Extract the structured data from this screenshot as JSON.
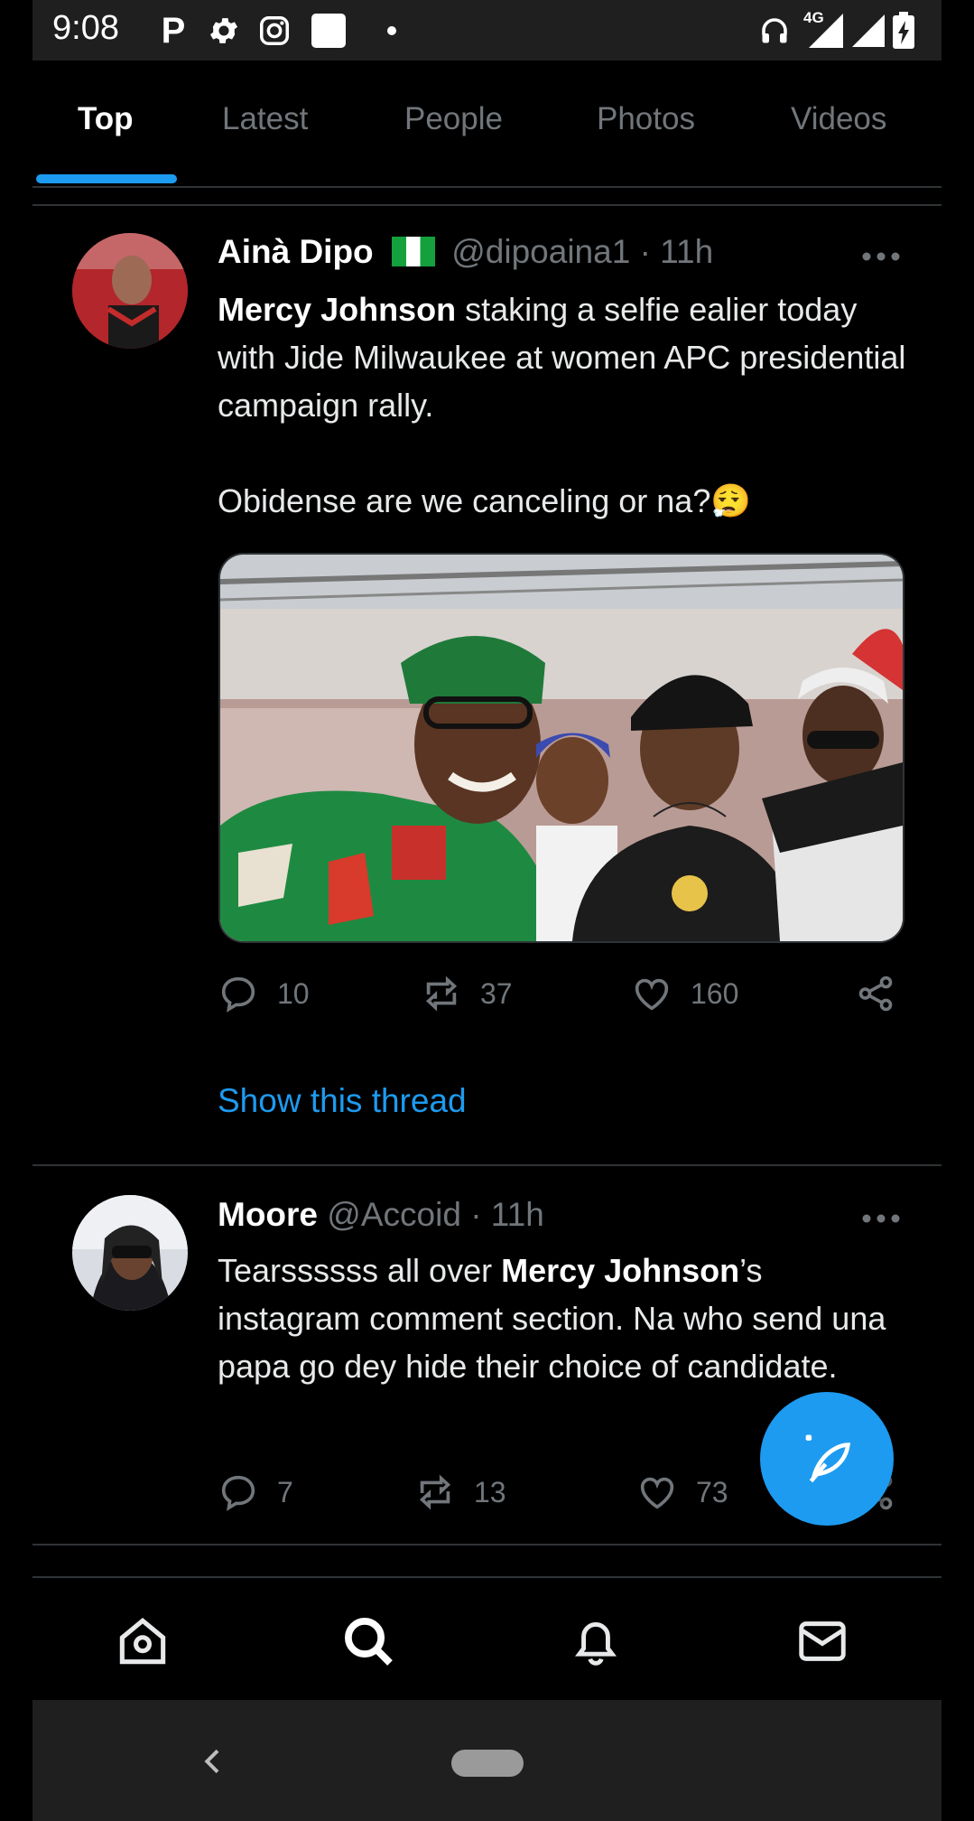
{
  "status_bar": {
    "time": "9:08",
    "left_icons": [
      "parking-p-icon",
      "gear-icon",
      "instagram-icon",
      "white-square-icon",
      "dot-icon"
    ],
    "network_label": "4G",
    "right_icons": [
      "headphones-icon",
      "signal-4g-icon",
      "signal-icon",
      "battery-charging-icon"
    ]
  },
  "tabs": [
    {
      "label": "Top",
      "active": true
    },
    {
      "label": "Latest",
      "active": false
    },
    {
      "label": "People",
      "active": false
    },
    {
      "label": "Photos",
      "active": false
    },
    {
      "label": "Videos",
      "active": false
    }
  ],
  "tweets": [
    {
      "name": "Ainà Dipo",
      "flag": "nigeria-flag-icon",
      "handle": "@dipoaina1",
      "time": "· 11h",
      "body_bold": "Mercy Johnson",
      "body_rest": " staking a selfie ealier today with Jide Milwaukee at women APC presidential campaign rally.",
      "body_line2": "Obidense are we canceling or na?",
      "emoji": "😮‍💨",
      "has_media": true,
      "replies": "10",
      "retweets": "37",
      "likes": "160",
      "thread_link": "Show this thread"
    },
    {
      "name": "Moore",
      "handle": "@Accoid",
      "time": "· 11h",
      "body_pre": "Tearssssss all over ",
      "body_bold": "Mercy Johnson",
      "body_post": "’s instagram comment section. Na who send una papa go dey hide their choice of candidate.",
      "replies": "7",
      "retweets": "13",
      "likes": "73"
    }
  ],
  "bottom_nav": [
    "home-icon",
    "search-icon",
    "bell-icon",
    "mail-icon"
  ],
  "colors": {
    "accent": "#1d9bf0",
    "background": "#000000",
    "muted": "#71767b",
    "divider": "#2f3336"
  }
}
